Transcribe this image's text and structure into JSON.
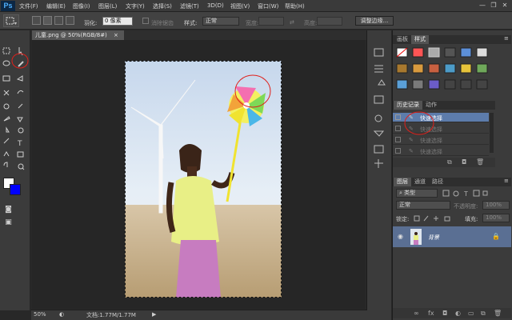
{
  "app": {
    "logo": "Ps",
    "menu": [
      "文件(F)",
      "编辑(E)",
      "图像(I)",
      "图层(L)",
      "文字(Y)",
      "选择(S)",
      "滤镜(T)",
      "3D(D)",
      "视图(V)",
      "窗口(W)",
      "帮助(H)"
    ],
    "window_controls": [
      "—",
      "❐",
      "✕"
    ]
  },
  "options": {
    "feather_label": "羽化:",
    "feather_value": "0 像素",
    "antialias_label": "消除锯齿",
    "style_label": "样式:",
    "style_value": "正常",
    "width_label": "宽度:",
    "height_label": "高度:",
    "refine_edge_label": "调整边缘..."
  },
  "document": {
    "tab_title": "儿童.png @ 50%(RGB/8#)",
    "tab_close": "×",
    "zoom": "50%",
    "doc_info": "文档:1.77M/1.77M"
  },
  "colors": {
    "foreground": "#ffffff",
    "background": "#0000ff",
    "accent": "#5a7ec0",
    "selection_circle": "#e0201b"
  },
  "styles_panel": {
    "tabs": [
      "画板",
      "样式"
    ],
    "active_tab": 1
  },
  "history_panel": {
    "tabs": [
      "历史记录",
      "动作"
    ],
    "items": [
      "快速选择",
      "快速选择",
      "快速选择",
      "快速选择"
    ],
    "active_index": 0
  },
  "layers_panel": {
    "tabs": [
      "图层",
      "通道",
      "路径"
    ],
    "filter_label": "类型",
    "blend_mode": "正常",
    "opacity_label": "不透明度:",
    "opacity_value": "100%",
    "lock_label": "锁定:",
    "fill_label": "填充:",
    "fill_value": "100%",
    "layers": [
      {
        "name": "背景",
        "visible": true,
        "locked": true
      }
    ]
  }
}
